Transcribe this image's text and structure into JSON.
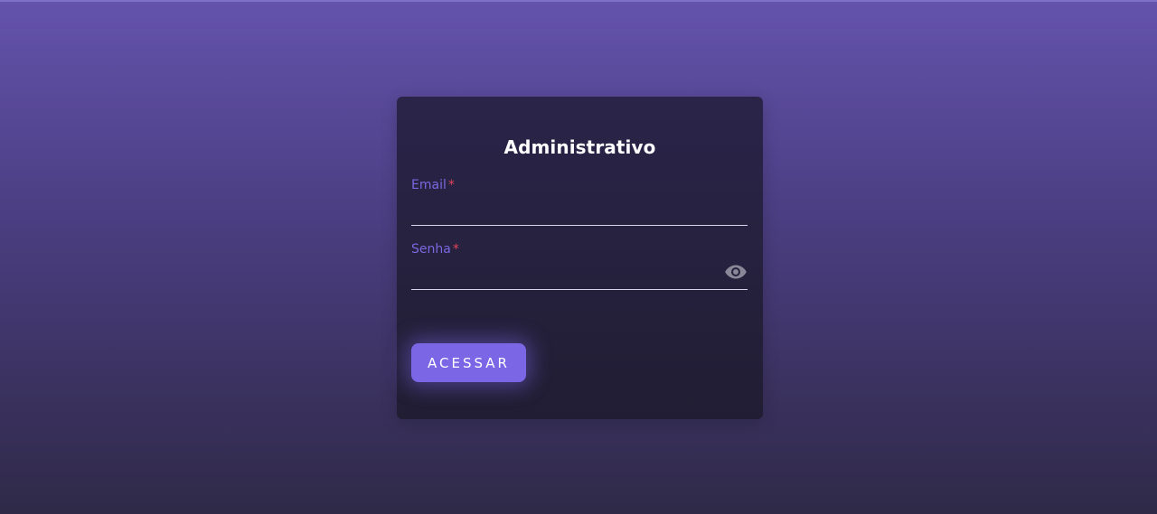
{
  "login": {
    "title": "Administrativo",
    "email": {
      "label": "Email",
      "required_mark": "*",
      "value": ""
    },
    "password": {
      "label": "Senha",
      "required_mark": "*",
      "value": "",
      "toggle_icon": "eye-icon"
    },
    "submit_label": "ACESSAR"
  },
  "colors": {
    "background_top": "#6453ac",
    "background_bottom": "#2f2a48",
    "card": "#27223f",
    "accent": "#7b66e6",
    "label": "#7b68e0",
    "required": "#e0455a"
  }
}
